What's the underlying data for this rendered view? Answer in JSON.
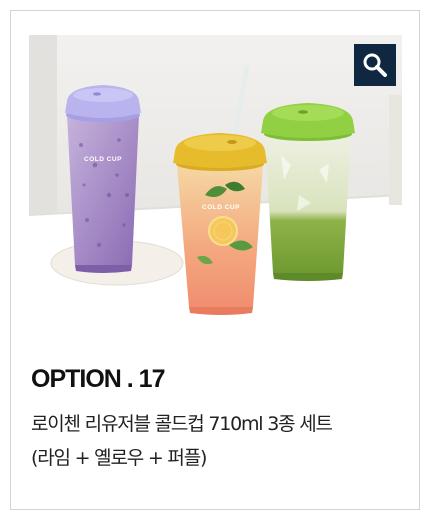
{
  "option": {
    "title": "OPTION . 17"
  },
  "product": {
    "name_line1": "로이첸 리유저블 콜드컵 710ml 3종 세트",
    "name_line2": "(라임 + 옐로우 + 퍼플)"
  },
  "photo": {
    "cup_label": "COLD CUP",
    "cups": [
      {
        "name": "purple-cup",
        "lid_color": "#b5b0ea",
        "drink_color": "#a789c8"
      },
      {
        "name": "yellow-cup",
        "lid_color": "#e6b92b",
        "drink_color": "#f3b18a"
      },
      {
        "name": "lime-cup",
        "lid_color": "#8ccc3e",
        "drink_color": "#a9cc6a"
      }
    ]
  },
  "icons": {
    "zoom": "search-icon"
  },
  "colors": {
    "zoom_button_bg": "#0f2740",
    "card_border": "#d4d4d4",
    "title_text": "#111111"
  }
}
